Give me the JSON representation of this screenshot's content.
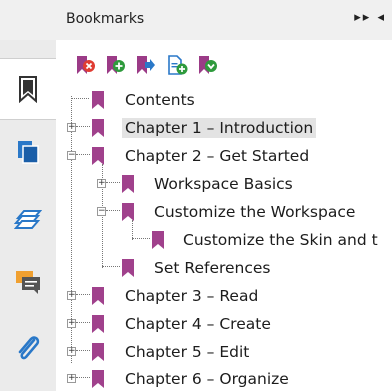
{
  "header": {
    "title": "Bookmarks",
    "controls": "▸▸ ◂"
  },
  "sidebar": {
    "items": [
      {
        "name": "bookmarks"
      },
      {
        "name": "pages"
      },
      {
        "name": "layers"
      },
      {
        "name": "comments"
      },
      {
        "name": "attachments"
      }
    ]
  },
  "toolbar": {
    "buttons": [
      "delete-bookmark",
      "add-bookmark",
      "add-child-bookmark",
      "new-bookmark-from-structure",
      "expand-bookmark"
    ]
  },
  "tree": {
    "rows": [
      {
        "label": "Contents"
      },
      {
        "label": "Chapter 1 – Introduction"
      },
      {
        "label": "Chapter 2 – Get Started"
      },
      {
        "label": "Workspace Basics"
      },
      {
        "label": "Customize the Workspace"
      },
      {
        "label": "Customize the Skin and t"
      },
      {
        "label": "Set References"
      },
      {
        "label": "Chapter 3 – Read"
      },
      {
        "label": "Chapter 4 – Create"
      },
      {
        "label": "Chapter 5 – Edit"
      },
      {
        "label": "Chapter 6 – Organize"
      }
    ]
  },
  "colors": {
    "bookmark": "#a0418c",
    "toolbar_icon": "#9b3b87",
    "panel_bg": "#ffffff",
    "sidebar_bg": "#ebebeb",
    "selected_bg": "#e3e3e3"
  }
}
